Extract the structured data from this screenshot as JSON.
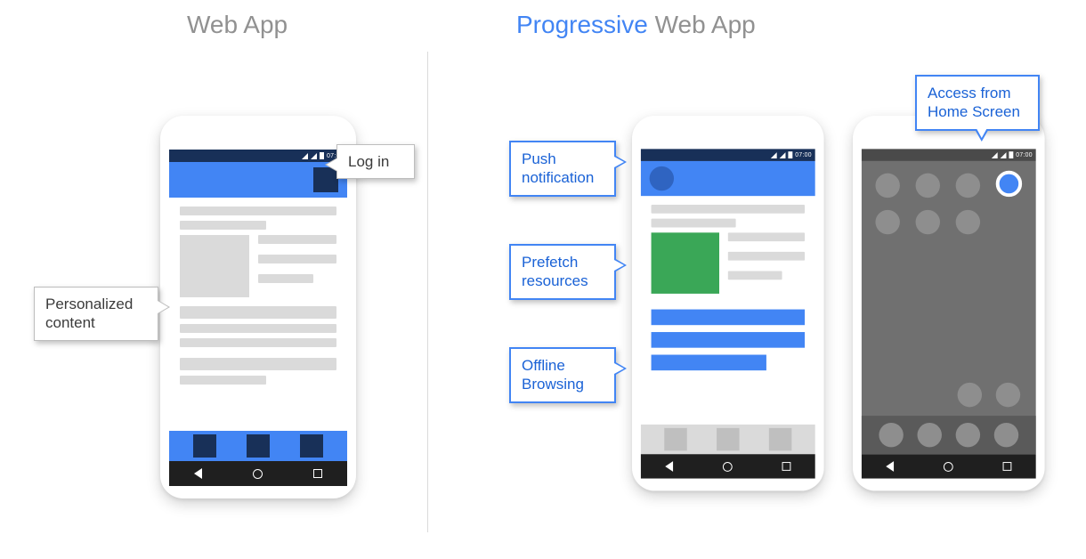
{
  "titles": {
    "left": "Web App",
    "right_accent": "Progressive",
    "right_rest": " Web App"
  },
  "status_time": "07:00",
  "callouts": {
    "login": "Log in",
    "personalized": "Personalized content",
    "push": "Push notification",
    "prefetch": "Prefetch resources",
    "offline": "Offline Browsing",
    "homescreen": "Access from Home Screen"
  }
}
